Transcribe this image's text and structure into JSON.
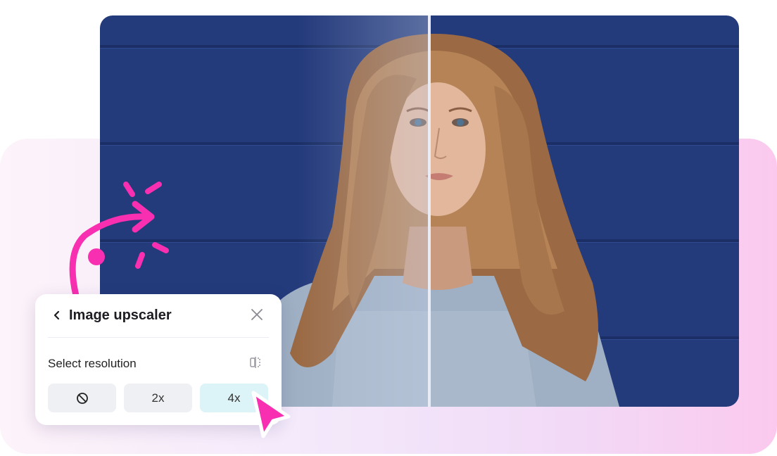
{
  "panel": {
    "title": "Image upscaler",
    "back_icon": "chevron-left-icon",
    "close_icon": "close-icon",
    "section_label": "Select resolution",
    "compare_icon": "compare-icon",
    "options": [
      {
        "label": "",
        "icon": "none-icon",
        "selected": false
      },
      {
        "label": "2x",
        "selected": false
      },
      {
        "label": "4x",
        "selected": true
      }
    ]
  },
  "colors": {
    "accent_pink": "#f72fb0",
    "photo_background": "#233a7b",
    "selected_option": "#dcf3f7"
  }
}
